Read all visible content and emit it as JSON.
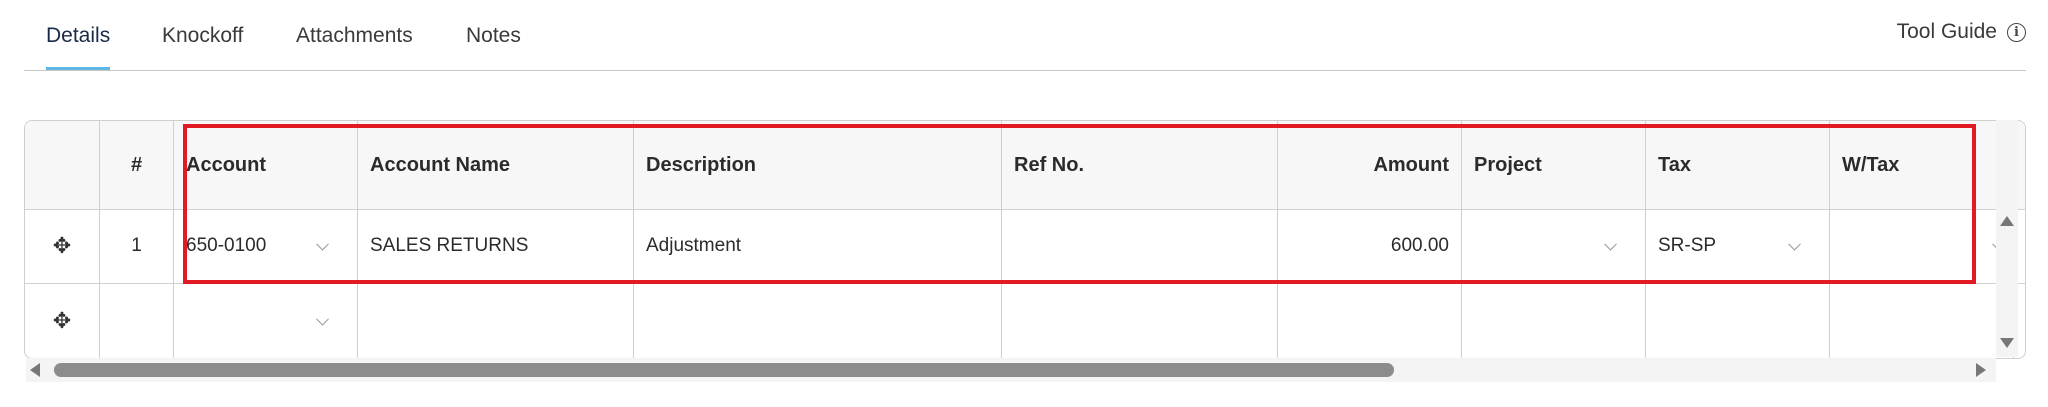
{
  "tabs": [
    {
      "label": "Details",
      "active": true
    },
    {
      "label": "Knockoff",
      "active": false
    },
    {
      "label": "Attachments",
      "active": false
    },
    {
      "label": "Notes",
      "active": false
    }
  ],
  "tool_guide": {
    "label": "Tool Guide",
    "icon": "info-icon"
  },
  "grid": {
    "headers": [
      "",
      "#",
      "Account",
      "Account Name",
      "Description",
      "Ref No.",
      "Amount",
      "Project",
      "Tax",
      "W/Tax"
    ],
    "rows": [
      {
        "drag_icon": "move-icon",
        "no": "1",
        "account": "650-0100",
        "account_name": "SALES RETURNS",
        "description": "Adjustment",
        "ref_no": "",
        "amount": "600.00",
        "project": "",
        "tax": "SR-SP",
        "wtax": ""
      },
      {
        "drag_icon": "move-icon",
        "no": "",
        "account": "",
        "account_name": "",
        "description": "",
        "ref_no": "",
        "amount": "",
        "project": "",
        "tax": "",
        "wtax": ""
      }
    ]
  },
  "colors": {
    "highlight": "#e01b24",
    "active_tab_underline": "#5fb7e2"
  }
}
